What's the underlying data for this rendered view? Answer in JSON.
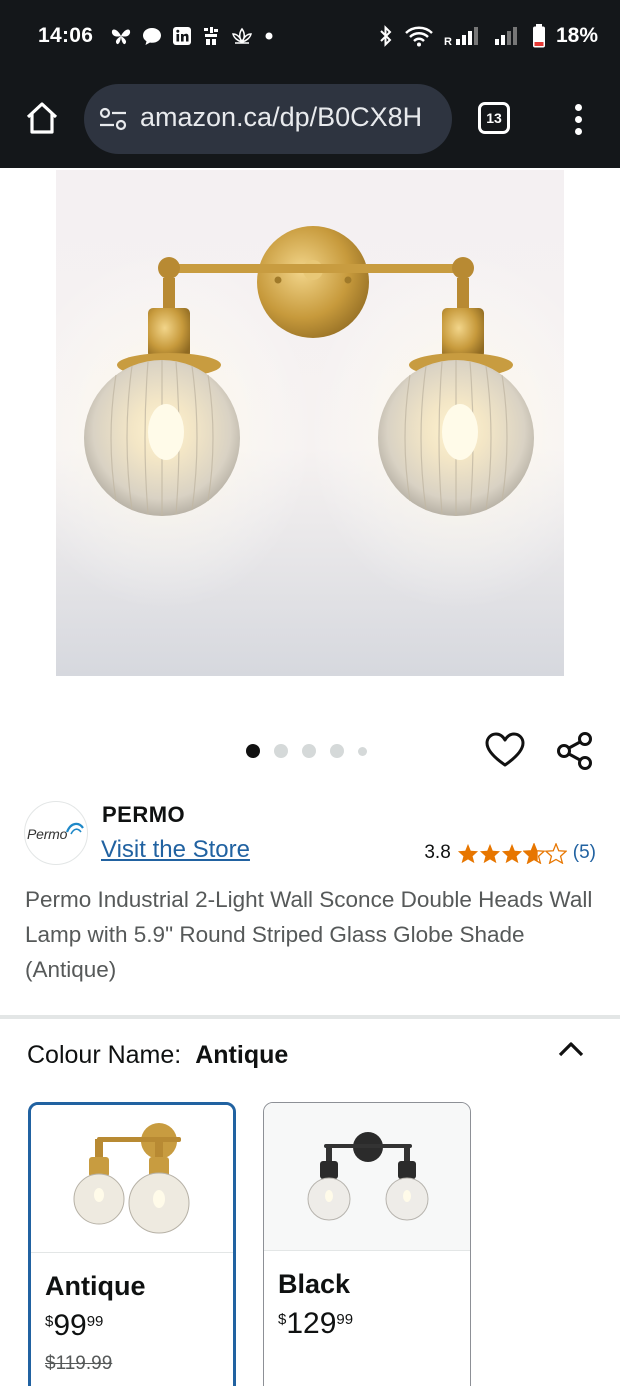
{
  "status_bar": {
    "time": "14:06",
    "battery": "18%",
    "left_icons": [
      "butterfly-icon",
      "chat-bubble-icon",
      "linkedin-icon",
      "app-icon",
      "lotus-icon",
      "dot-icon"
    ],
    "right_icons": [
      "bluetooth-icon",
      "wifi-icon",
      "signal-r-icon",
      "signal-icon",
      "battery-icon"
    ]
  },
  "browser": {
    "url": "amazon.ca/dp/B0CX8H",
    "tab_count": "13"
  },
  "carousel": {
    "total": 5,
    "active_index": 0
  },
  "brand": {
    "logo_text": "Permo",
    "name": "PERMO",
    "store_link": "Visit the Store"
  },
  "rating": {
    "value": "3.8",
    "stars": 3.8,
    "count": "(5)"
  },
  "product": {
    "title": "Permo Industrial 2-Light Wall Sconce Double Heads Wall Lamp with 5.9\" Round Striped Glass Globe Shade (Antique)"
  },
  "variation": {
    "label": "Colour Name:",
    "selected": "Antique",
    "options": [
      {
        "name": "Antique",
        "price_symbol": "$",
        "price_whole": "99",
        "price_fraction": "99",
        "list_price": "$119.99"
      },
      {
        "name": "Black",
        "price_symbol": "$",
        "price_whole": "129",
        "price_fraction": "99"
      }
    ]
  },
  "colors": {
    "link": "#2162a1",
    "star": "#e77600",
    "selected_border": "#2162a1",
    "status_bg": "#14171a"
  }
}
